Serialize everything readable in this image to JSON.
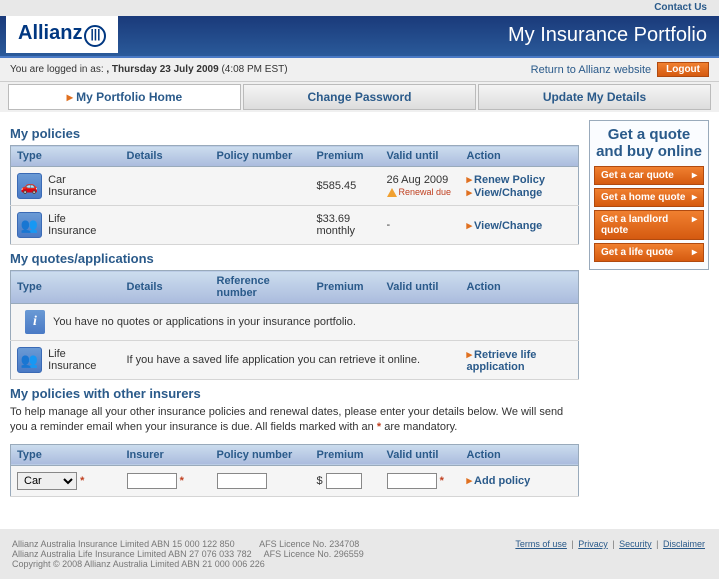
{
  "topbar": {
    "contact": "Contact Us"
  },
  "header": {
    "logo": "Allianz",
    "title": "My Insurance Portfolio"
  },
  "loginbar": {
    "prefix": "You are logged in as:",
    "date": ", Thursday 23 July 2009",
    "time": "(4:08 PM EST)",
    "return": "Return to Allianz website",
    "logout": "Logout"
  },
  "tabs": {
    "home": "My Portfolio Home",
    "password": "Change Password",
    "details": "Update My Details"
  },
  "policies": {
    "title": "My policies",
    "headers": {
      "type": "Type",
      "details": "Details",
      "policy": "Policy number",
      "premium": "Premium",
      "valid": "Valid until",
      "action": "Action"
    },
    "rows": [
      {
        "type": "Car Insurance",
        "premium": "$585.45",
        "valid": "26 Aug 2009",
        "warn": "Renewal due",
        "actions": [
          "Renew Policy",
          "View/Change"
        ]
      },
      {
        "type": "Life Insurance",
        "premium": "$33.69 monthly",
        "valid": "-",
        "actions": [
          "View/Change"
        ]
      }
    ]
  },
  "quotes": {
    "title": "My quotes/applications",
    "headers": {
      "type": "Type",
      "details": "Details",
      "ref": "Reference number",
      "premium": "Premium",
      "valid": "Valid until",
      "action": "Action"
    },
    "empty": "You have no quotes or applications in your insurance portfolio.",
    "life_type": "Life Insurance",
    "life_msg": "If you have a saved life application you can retrieve it online.",
    "retrieve": "Retrieve life application"
  },
  "other": {
    "title": "My policies with other insurers",
    "intro_a": "To help manage all your other insurance policies and renewal dates, please enter your details below. We will send you a reminder email when your insurance is due. All fields marked with an ",
    "intro_b": " are mandatory.",
    "headers": {
      "type": "Type",
      "insurer": "Insurer",
      "policy": "Policy number",
      "premium": "Premium",
      "valid": "Valid until",
      "action": "Action"
    },
    "type_option": "Car",
    "dollar": "$",
    "add": "Add policy"
  },
  "sidebar": {
    "title_a": "Get a quote",
    "title_b": "and buy online",
    "car": "Get a car quote",
    "home": "Get a home quote",
    "landlord": "Get a landlord quote",
    "life": "Get a life quote"
  },
  "footer": {
    "l1": "Allianz Australia Insurance Limited ABN 15 000 122 850",
    "afs1": "AFS Licence No. 234708",
    "l2": "Allianz Australia Life Insurance Limited ABN 27 076 033 782",
    "afs2": "AFS Licence No. 296559",
    "l3": "Copyright © 2008 Allianz Australia Limited ABN 21 000 006 226",
    "links": {
      "terms": "Terms of use",
      "privacy": "Privacy",
      "security": "Security",
      "disclaimer": "Disclaimer"
    }
  }
}
